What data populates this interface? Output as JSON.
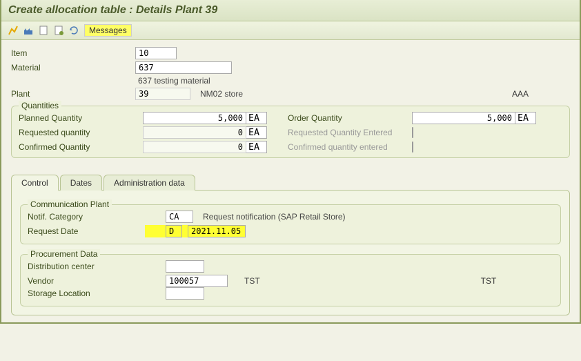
{
  "title": "Create allocation table : Details Plant 39",
  "toolbar": {
    "messages_label": "Messages"
  },
  "header": {
    "item_label": "Item",
    "item_value": "10",
    "material_label": "Material",
    "material_value": "637",
    "material_desc": "637 testing material",
    "plant_label": "Plant",
    "plant_value": "39",
    "plant_desc": "NM02 store",
    "plant_extra": "AAA"
  },
  "quantities": {
    "legend": "Quantities",
    "planned_label": "Planned Quantity",
    "planned_value": "5,000",
    "planned_unit": "EA",
    "requested_label": "Requested quantity",
    "requested_value": "0",
    "requested_unit": "EA",
    "confirmed_label": "Confirmed Quantity",
    "confirmed_value": "0",
    "confirmed_unit": "EA",
    "order_label": "Order Quantity",
    "order_value": "5,000",
    "order_unit": "EA",
    "req_entered_label": "Requested Quantity Entered",
    "conf_entered_label": "Confirmed quantity entered"
  },
  "tabs": {
    "control": "Control",
    "dates": "Dates",
    "admin": "Administration data"
  },
  "comm": {
    "legend": "Communication Plant",
    "notif_label": "Notif. Category",
    "notif_value": "CA",
    "notif_desc": "Request notification  (SAP Retail Store)",
    "reqdate_label": "Request Date",
    "reqdate_code": "D",
    "reqdate_value": "2021.11.05"
  },
  "proc": {
    "legend": "Procurement Data",
    "dc_label": "Distribution center",
    "dc_value": "",
    "vendor_label": "Vendor",
    "vendor_value": "100057",
    "vendor_desc": "TST",
    "vendor_desc2": "TST",
    "sloc_label": "Storage Location",
    "sloc_value": ""
  }
}
